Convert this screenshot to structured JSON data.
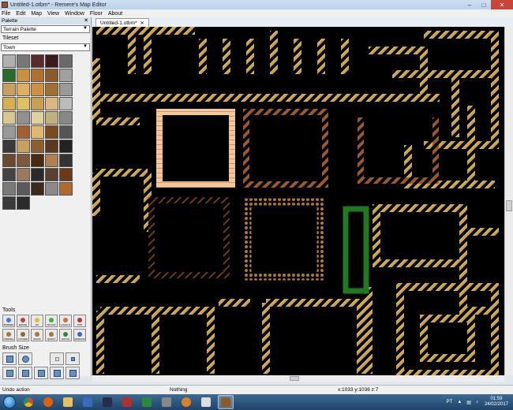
{
  "window": {
    "title": "Untitled-1.otbm* - Remere's Map Editor"
  },
  "menu": {
    "items": [
      "File",
      "Edit",
      "Map",
      "View",
      "Window",
      "Floor",
      "About"
    ]
  },
  "palette": {
    "title": "Palette",
    "palette_selected": "Terrain Palette",
    "tileset_label": "Tileset",
    "tileset_selected": "Town"
  },
  "tools": {
    "label": "Tools",
    "items": [
      {
        "name": "BORDER",
        "color": "#3a7fd0"
      },
      {
        "name": "ERASE",
        "color": "#d03a3a"
      },
      {
        "name": "PZ",
        "color": "#e0c030"
      },
      {
        "name": "NO PVP",
        "color": "#3ab040"
      },
      {
        "name": "LOGOUT",
        "color": "#d07030"
      },
      {
        "name": "PVP",
        "color": "#c03030"
      },
      {
        "name": "NORMAL",
        "color": "#9a7a40"
      },
      {
        "name": "LOCKED",
        "color": "#8a6a30"
      },
      {
        "name": "MAGIC",
        "color": "#9a7a40"
      },
      {
        "name": "QUEST",
        "color": "#9a7a40"
      },
      {
        "name": "HATCH",
        "color": "#2a8a3a"
      },
      {
        "name": "WINDOW",
        "color": "#3a6ab0"
      }
    ]
  },
  "brush_size": {
    "label": "Brush Size"
  },
  "tab": {
    "label": "Untitled-1.otbm*"
  },
  "status": {
    "action": "Undo action",
    "item": "Nothing",
    "coords": "x:1033 y:1036 z:7"
  },
  "taskbar": {
    "lang": "PT",
    "time": "01:59",
    "date": "24/02/2017"
  },
  "colors": {
    "wall_gold": "#c9a24a",
    "wall_light_wood": "#f2c89a",
    "wall_brown": "#9a5a2e",
    "wall_dark_brown": "#6e3a18",
    "wall_ornate": "#b0782e",
    "green_wall": "#1f7a1f"
  }
}
